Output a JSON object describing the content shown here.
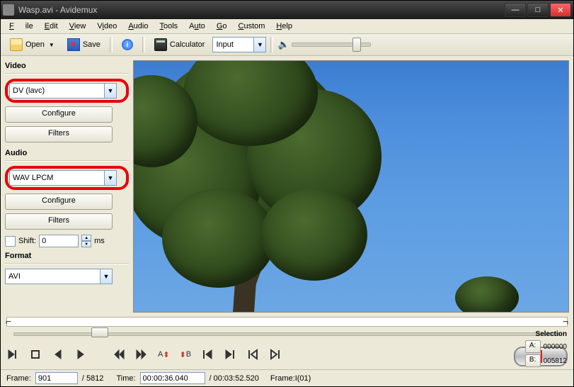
{
  "titlebar": {
    "text": "Wasp.avi - Avidemux"
  },
  "menu": {
    "items": [
      "File",
      "Edit",
      "View",
      "Video",
      "Audio",
      "Tools",
      "Auto",
      "Go",
      "Custom",
      "Help"
    ]
  },
  "toolbar": {
    "open": "Open",
    "save": "Save",
    "calculator": "Calculator",
    "mode": "Input"
  },
  "sidebar": {
    "video": {
      "label": "Video",
      "codec": "DV (lavc)",
      "configure": "Configure",
      "filters": "Filters"
    },
    "audio": {
      "label": "Audio",
      "codec": "WAV LPCM",
      "configure": "Configure",
      "filters": "Filters",
      "shift_label": "Shift:",
      "shift_value": "0",
      "shift_unit": "ms"
    },
    "format": {
      "label": "Format",
      "container": "AVI"
    }
  },
  "selection": {
    "label": "Selection",
    "a_label": "A:",
    "a_value": "000000",
    "b_label": "B:",
    "b_value": "005812"
  },
  "status": {
    "frame_label": "Frame:",
    "frame_value": "901",
    "frame_total": "/ 5812",
    "time_label": "Time:",
    "time_value": "00:00:36.040",
    "time_total": "/ 00:03:52.520",
    "frame_type": "Frame:I(01)"
  }
}
